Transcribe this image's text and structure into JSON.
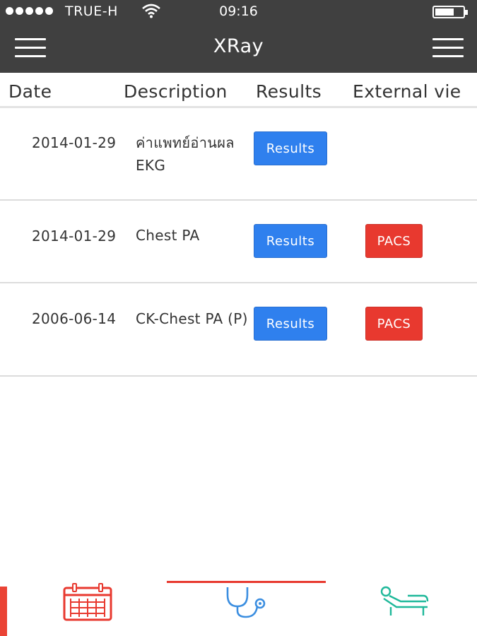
{
  "status_bar": {
    "carrier": "TRUE-H",
    "time": "09:16"
  },
  "header": {
    "title": "XRay"
  },
  "table": {
    "columns": [
      "Date",
      "Description",
      "Results",
      "External vie"
    ],
    "rows": [
      {
        "date": "2014-01-29",
        "description": "ค่าแพทย์อ่านผล EKG",
        "results_label": "Results",
        "external_label": ""
      },
      {
        "date": "2014-01-29",
        "description": "Chest PA",
        "results_label": "Results",
        "external_label": "PACS"
      },
      {
        "date": "2006-06-14",
        "description": "CK-Chest PA (P)",
        "results_label": "Results",
        "external_label": "PACS"
      }
    ]
  },
  "tabbar": {
    "tabs": [
      {
        "icon": "calendar-icon",
        "color": "#e8392f"
      },
      {
        "icon": "stethoscope-icon",
        "color": "#3b8ee0",
        "selected": true
      },
      {
        "icon": "patient-bed-icon",
        "color": "#1fb89a"
      }
    ]
  },
  "colors": {
    "nav_background": "#404040",
    "results_button": "#2f80ee",
    "pacs_button": "#e8392f",
    "tab_indicator": "#e8392f"
  }
}
